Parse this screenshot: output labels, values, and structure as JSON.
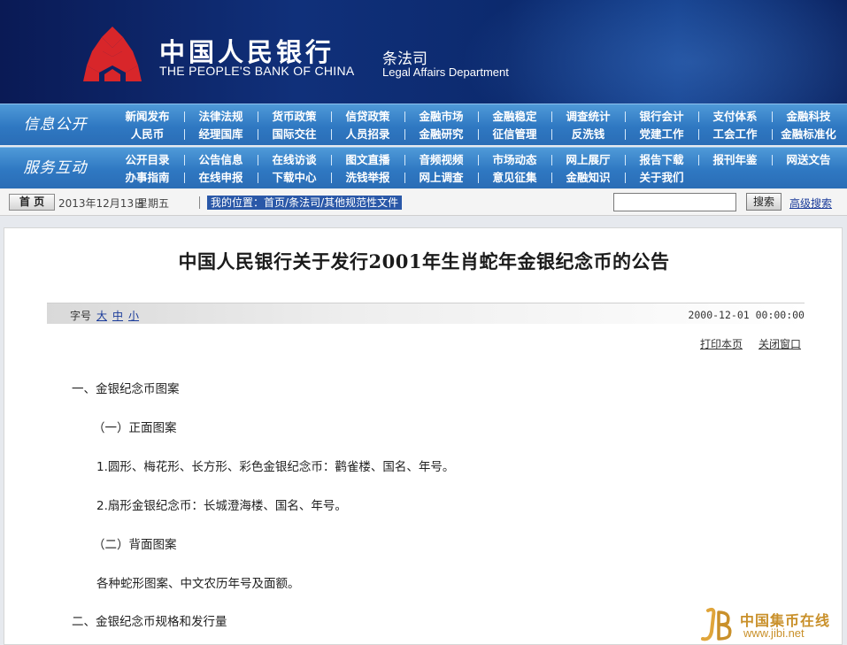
{
  "header": {
    "bank_name_cn": "中国人民银行",
    "bank_name_en": "THE PEOPLE'S BANK OF CHINA",
    "dept_cn": "条法司",
    "dept_en": "Legal Affairs Department",
    "logo_icon": "pboc-logo-icon",
    "colors": {
      "banner": "#10307a",
      "logo": "#d8262a"
    }
  },
  "nav": [
    {
      "label": "信息公开",
      "items": [
        [
          "新闻发布",
          "法律法规",
          "货币政策",
          "信贷政策",
          "金融市场",
          "金融稳定",
          "调查统计",
          "银行会计",
          "支付体系",
          "金融科技"
        ],
        [
          "人民币",
          "经理国库",
          "国际交往",
          "人员招录",
          "金融研究",
          "征信管理",
          "反洗钱",
          "党建工作",
          "工会工作",
          "金融标准化"
        ]
      ]
    },
    {
      "label": "服务互动",
      "items": [
        [
          "公开目录",
          "公告信息",
          "在线访谈",
          "图文直播",
          "音频视频",
          "市场动态",
          "网上展厅",
          "报告下载",
          "报刊年鉴",
          "网送文告"
        ],
        [
          "办事指南",
          "在线申报",
          "下载中心",
          "洗钱举报",
          "网上调查",
          "意见征集",
          "金融知识",
          "关于我们"
        ]
      ]
    }
  ],
  "toolbar": {
    "home_label": "首 页",
    "date": "2013年12月13日",
    "weekday": "星期五",
    "location_prefix": "我的位置：",
    "breadcrumb": [
      "首页",
      "条法司",
      "其他规范性文件"
    ],
    "breadcrumb_sep": "/",
    "search_value": "",
    "search_label": "搜索",
    "advanced_search": "高级搜索"
  },
  "article": {
    "title": "中国人民银行关于发行2001年生肖蛇年金银纪念币的公告",
    "font_label": "字号",
    "font_sizes": [
      "大",
      "中",
      "小"
    ],
    "publish_time": "2000-12-01 00:00:00",
    "print_label": "打印本页",
    "close_label": "关闭窗口",
    "paragraphs": [
      "一、金银纪念币图案",
      "（一）正面图案",
      "1.圆形、梅花形、长方形、彩色金银纪念币：鹳雀楼、国名、年号。",
      "2.扇形金银纪念币：长城澄海楼、国名、年号。",
      "（二）背面图案",
      "各种蛇形图案、中文农历年号及面额。",
      "二、金银纪念币规格和发行量"
    ]
  },
  "watermark": {
    "name_cn": "中国集币在线",
    "url": "www.jibi.net",
    "color": "#c9902a"
  }
}
